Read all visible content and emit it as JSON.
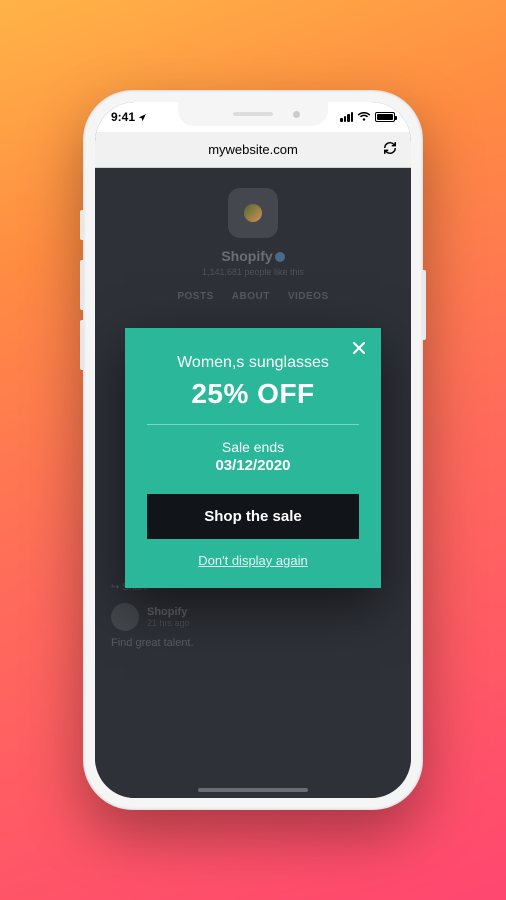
{
  "status": {
    "time": "9:41",
    "location_arrow": "➤"
  },
  "browser": {
    "url": "mywebsite.com"
  },
  "background": {
    "profile_name": "Shopify",
    "profile_sub": "1,141,681 people like this",
    "tabs": [
      "POSTS",
      "ABOUT",
      "VIDEOS"
    ],
    "share_label": "Share",
    "post_user": "Shopify",
    "post_time": "21 hrs ago",
    "post_body": "Find great talent."
  },
  "popup": {
    "title": "Women,s sunglasses",
    "discount": "25% OFF",
    "ends_label": "Sale ends",
    "ends_date": "03/12/2020",
    "cta": "Shop the sale",
    "dismiss": "Don't display again"
  }
}
